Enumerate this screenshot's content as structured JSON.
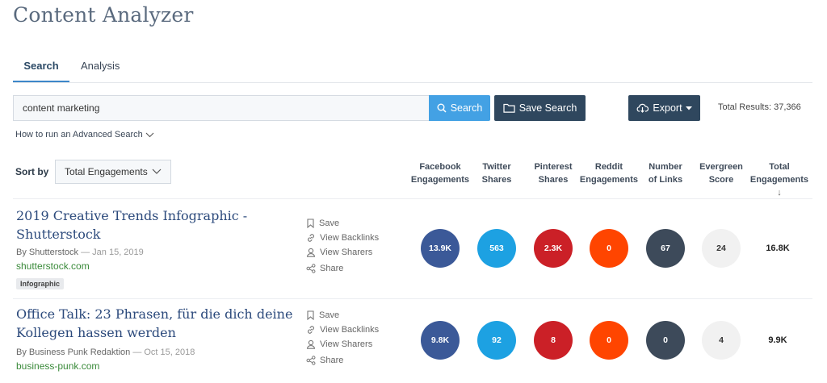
{
  "page": {
    "title": "Content Analyzer"
  },
  "tabs": [
    {
      "label": "Search"
    },
    {
      "label": "Analysis"
    }
  ],
  "search": {
    "value": "content marketing",
    "button_label": "Search"
  },
  "save_search": {
    "label": "Save Search"
  },
  "export": {
    "label": "Export"
  },
  "total_results": "Total Results: 37,366",
  "advanced_link": "How to run an Advanced Search",
  "sort": {
    "label": "Sort by",
    "selected": "Total Engagements"
  },
  "columns": [
    {
      "line1": "Facebook",
      "line2": "Engagements"
    },
    {
      "line1": "Twitter",
      "line2": "Shares"
    },
    {
      "line1": "Pinterest",
      "line2": "Shares"
    },
    {
      "line1": "Reddit",
      "line2": "Engagements"
    },
    {
      "line1": "Number",
      "line2": "of Links"
    },
    {
      "line1": "Evergreen",
      "line2": "Score"
    },
    {
      "line1": "Total",
      "line2": "Engagements",
      "arrow": "↓"
    }
  ],
  "actions": {
    "save": "Save",
    "view_backlinks": "View Backlinks",
    "view_sharers": "View Sharers",
    "share": "Share"
  },
  "colors": {
    "facebook": "#3b5998",
    "twitter": "#1da1e2",
    "pinterest": "#cb2027",
    "reddit": "#ff4500",
    "links": "#3d4a5a",
    "evergreen": "#f1f1f1"
  },
  "results": [
    {
      "title": "2019 Creative Trends Infographic - Shutterstock",
      "author": "By Shutterstock",
      "date": "— Jan 15, 2019",
      "domain": "shutterstock.com",
      "tag": "Infographic",
      "facebook": "13.9K",
      "twitter": "563",
      "pinterest": "2.3K",
      "reddit": "0",
      "links": "67",
      "evergreen": "24",
      "total": "16.8K"
    },
    {
      "title": "Office Talk: 23 Phrasen, für die dich deine Kollegen hassen werden",
      "author": "By Business Punk Redaktion",
      "date": "— Oct 15, 2018",
      "domain": "business-punk.com",
      "facebook": "9.8K",
      "twitter": "92",
      "pinterest": "8",
      "reddit": "0",
      "links": "0",
      "evergreen": "4",
      "total": "9.9K"
    }
  ]
}
